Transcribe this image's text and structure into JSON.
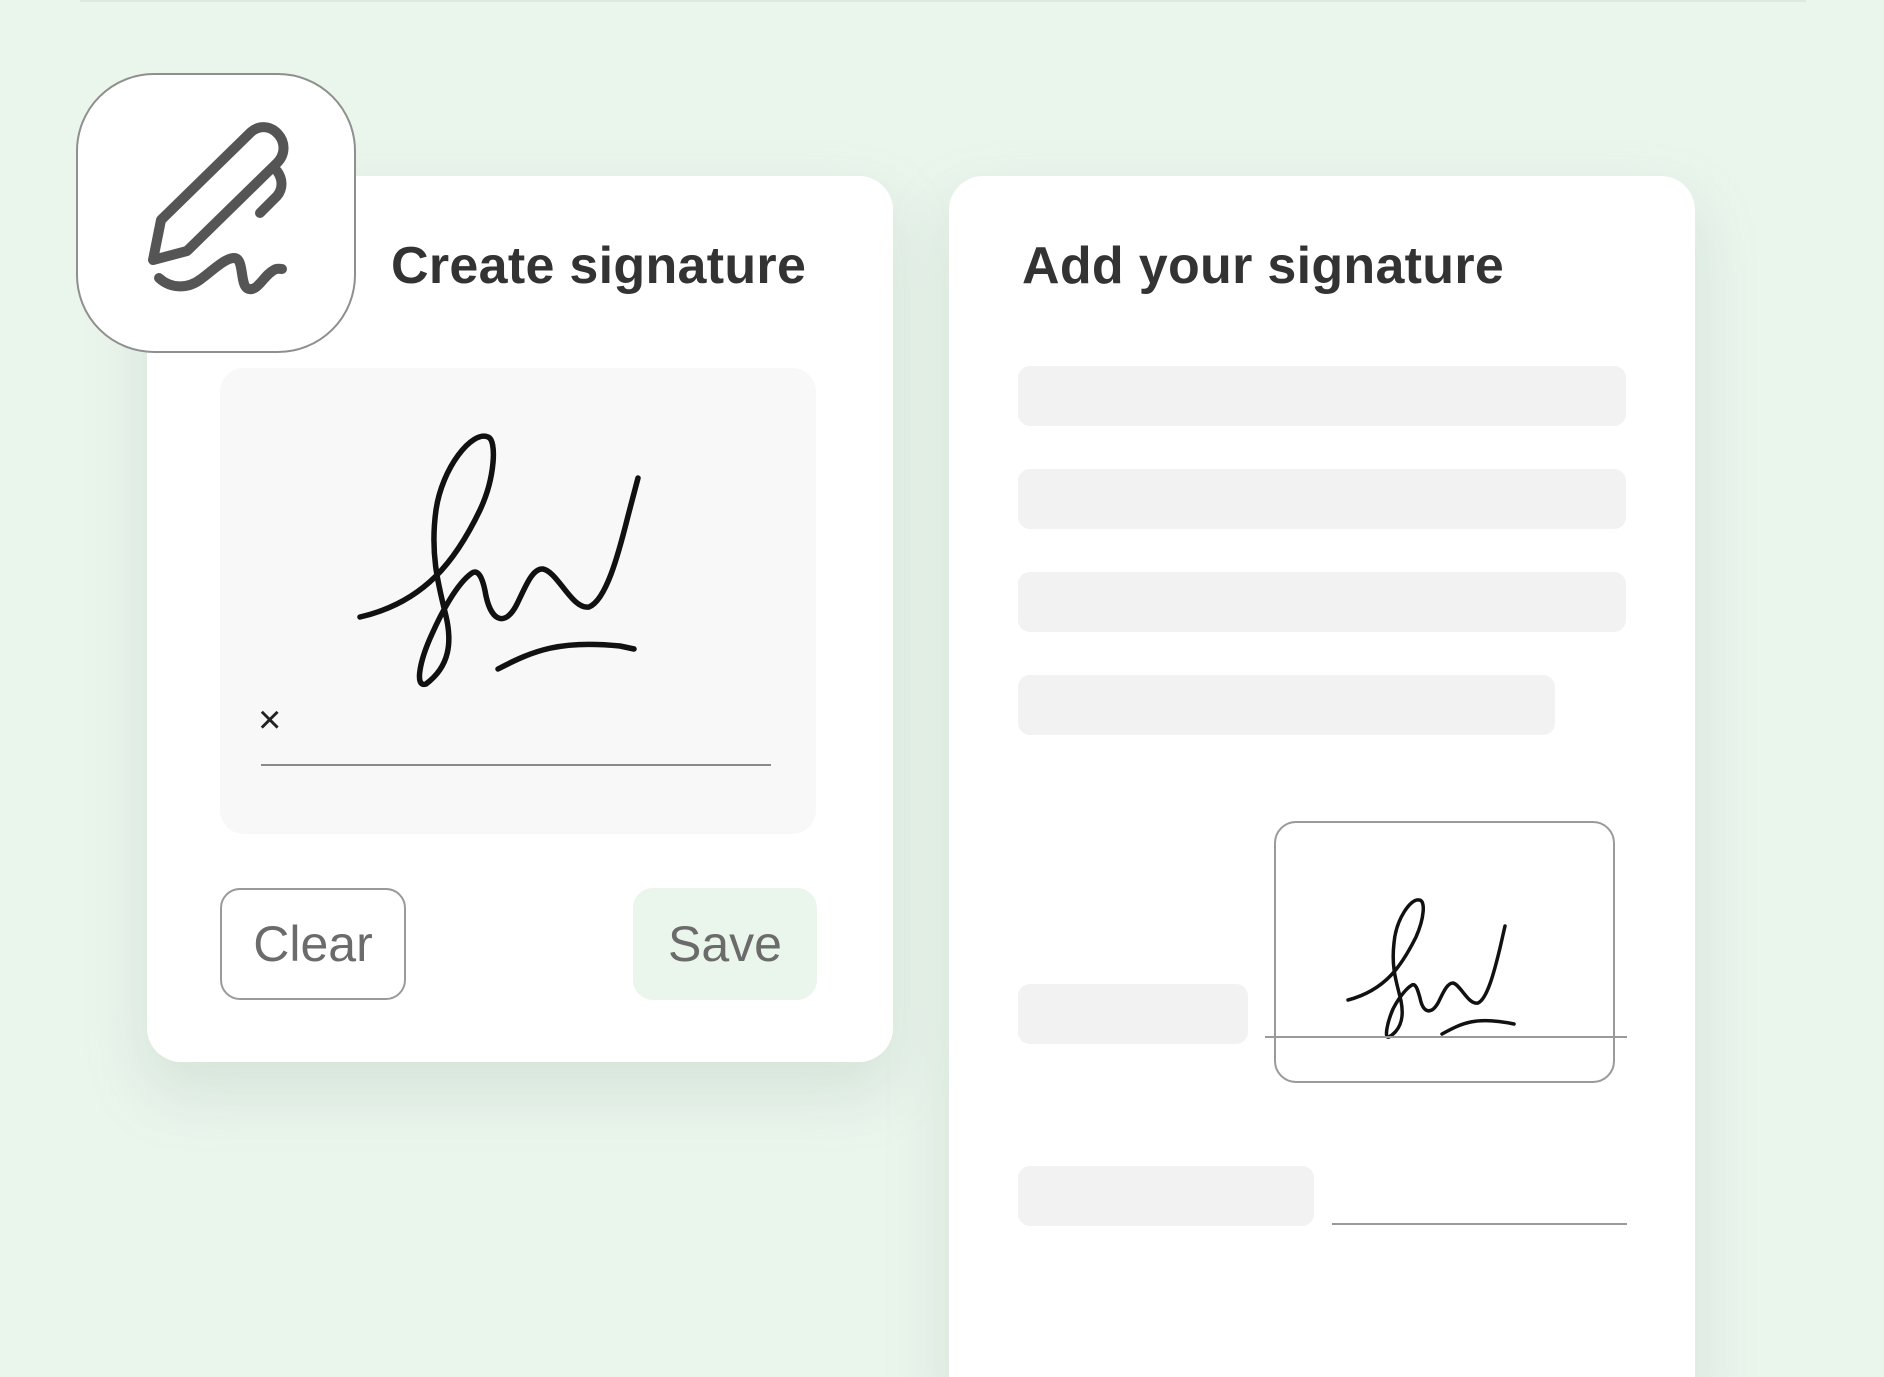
{
  "create_panel": {
    "title": "Create signature",
    "pad": {
      "clear_mark": "×"
    },
    "buttons": {
      "clear_label": "Clear",
      "save_label": "Save"
    }
  },
  "add_panel": {
    "title": "Add your signature"
  },
  "icons": {
    "badge": "pen-signature-icon",
    "pad_clear": "close-icon"
  },
  "colors": {
    "background": "#eaf5ec",
    "card": "#ffffff",
    "title_text": "#333333",
    "button_text": "#6b6b6b",
    "save_button_bg": "#eaf5ec",
    "placeholder": "#f2f2f2",
    "ink": "#111111",
    "icon_stroke": "#555555"
  }
}
